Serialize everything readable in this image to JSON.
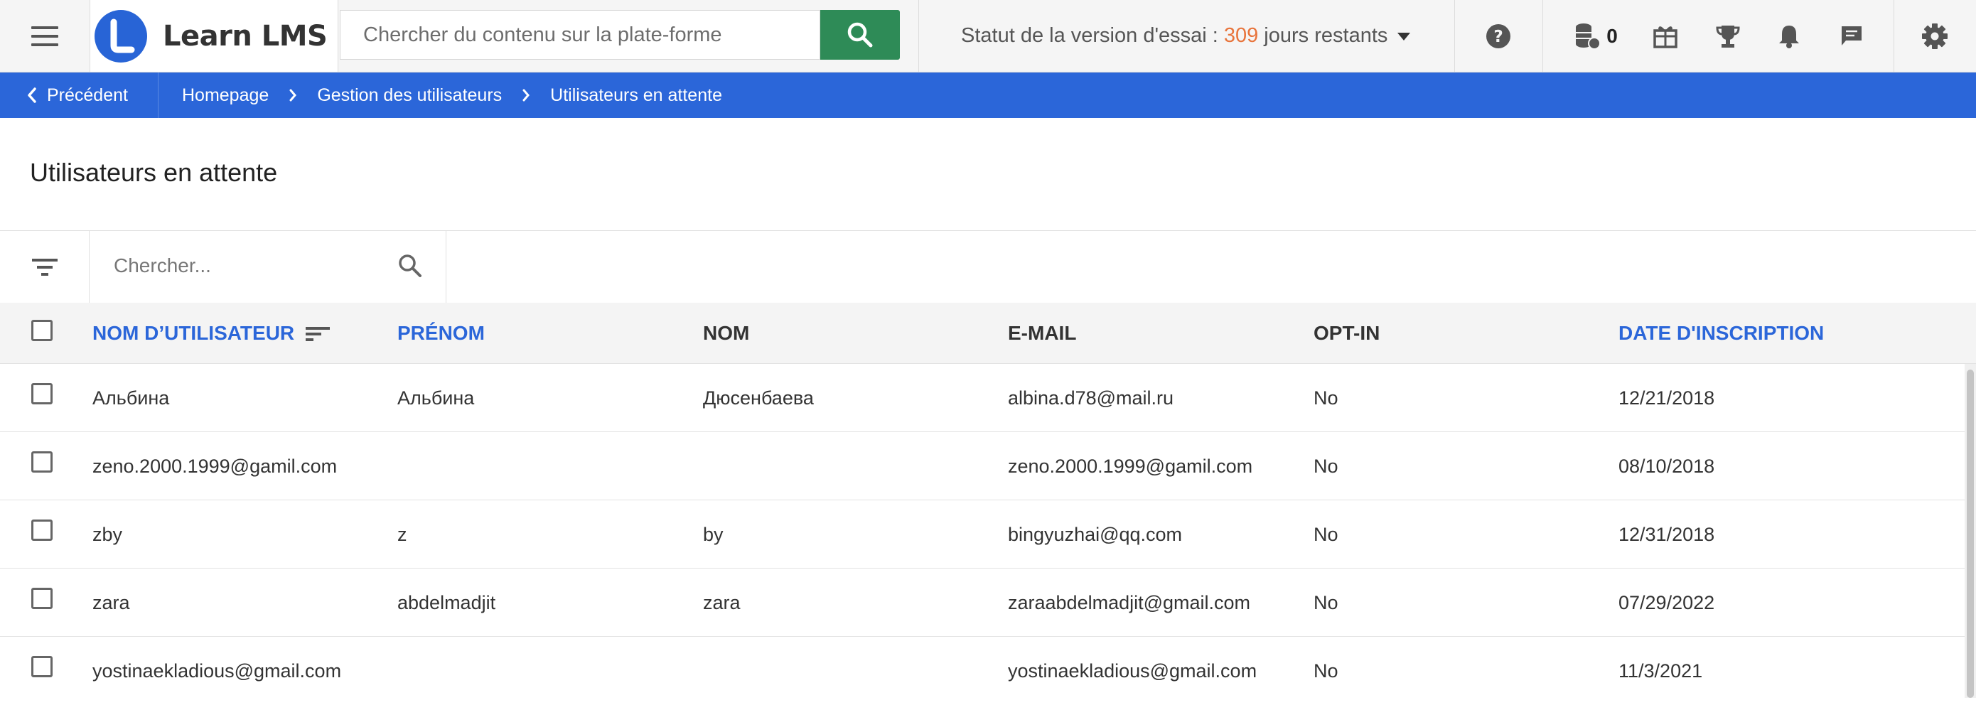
{
  "app": {
    "name": "Learn LMS",
    "search_placeholder": "Chercher du contenu sur la plate-forme"
  },
  "trial": {
    "label": "Statut de la version d'essai : ",
    "days": "309",
    "suffix": " jours restants"
  },
  "header_icons": {
    "help": "help-icon",
    "coins": "coins-icon",
    "coins_count": "0",
    "gift": "gift-icon",
    "trophy": "trophy-icon",
    "bell": "bell-icon",
    "chat": "chat-icon",
    "settings": "gear-icon"
  },
  "breadcrumb": {
    "back_label": "Précédent",
    "items": [
      "Homepage",
      "Gestion des utilisateurs",
      "Utilisateurs en attente"
    ]
  },
  "page": {
    "title": "Utilisateurs en attente"
  },
  "filter": {
    "search_placeholder": "Chercher..."
  },
  "table": {
    "columns": [
      "NOM D’UTILISATEUR",
      "PRÉNOM",
      "NOM",
      "E-MAIL",
      "OPT-IN",
      "DATE D'INSCRIPTION"
    ],
    "rows": [
      {
        "username": "Альбина",
        "first": "Альбина",
        "last": "Дюсенбаева",
        "email": "albina.d78@mail.ru",
        "optin": "No",
        "date": "12/21/2018"
      },
      {
        "username": "zeno.2000.1999@gamil.com",
        "first": "",
        "last": "",
        "email": "zeno.2000.1999@gamil.com",
        "optin": "No",
        "date": "08/10/2018"
      },
      {
        "username": "zby",
        "first": "z",
        "last": "by",
        "email": "bingyuzhai@qq.com",
        "optin": "No",
        "date": "12/31/2018"
      },
      {
        "username": "zara",
        "first": "abdelmadjit",
        "last": "zara",
        "email": "zaraabdelmadjit@gmail.com",
        "optin": "No",
        "date": "07/29/2022"
      },
      {
        "username": "yostinaekladious@gmail.com",
        "first": "",
        "last": "",
        "email": "yostinaekladious@gmail.com",
        "optin": "No",
        "date": "11/3/2021"
      }
    ]
  },
  "colors": {
    "accent": "#2b66d9",
    "search_button": "#2e8b57",
    "trial_days": "#e8743b"
  }
}
